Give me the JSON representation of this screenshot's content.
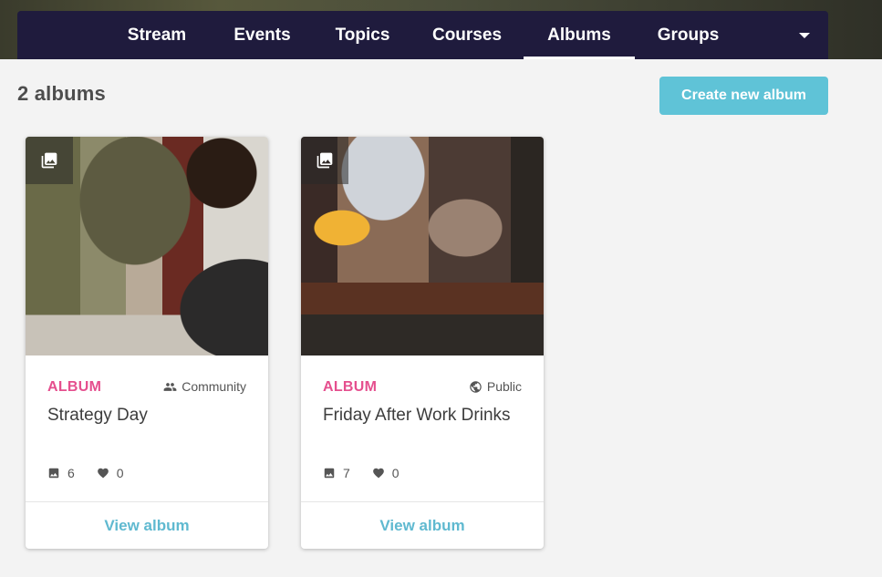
{
  "nav": {
    "tabs": [
      {
        "label": "Stream"
      },
      {
        "label": "Events"
      },
      {
        "label": "Topics"
      },
      {
        "label": "Courses"
      },
      {
        "label": "Albums",
        "active": true
      },
      {
        "label": "Groups"
      }
    ],
    "more_icon": "chevron-down-icon"
  },
  "page": {
    "count_title": "2 albums",
    "create_button": "Create new album"
  },
  "albums": [
    {
      "type": "ALBUM",
      "visibility": "Community",
      "visibility_icon": "people-icon",
      "title": "Strategy Day",
      "photos": "6",
      "likes": "0",
      "view_label": "View album"
    },
    {
      "type": "ALBUM",
      "visibility": "Public",
      "visibility_icon": "globe-icon",
      "title": "Friday After Work Drinks",
      "photos": "7",
      "likes": "0",
      "view_label": "View album"
    }
  ],
  "colors": {
    "nav_bg": "#1f1b3d",
    "accent": "#5fc3d7",
    "album_label": "#e54f8e",
    "link": "#5fb9d0"
  }
}
